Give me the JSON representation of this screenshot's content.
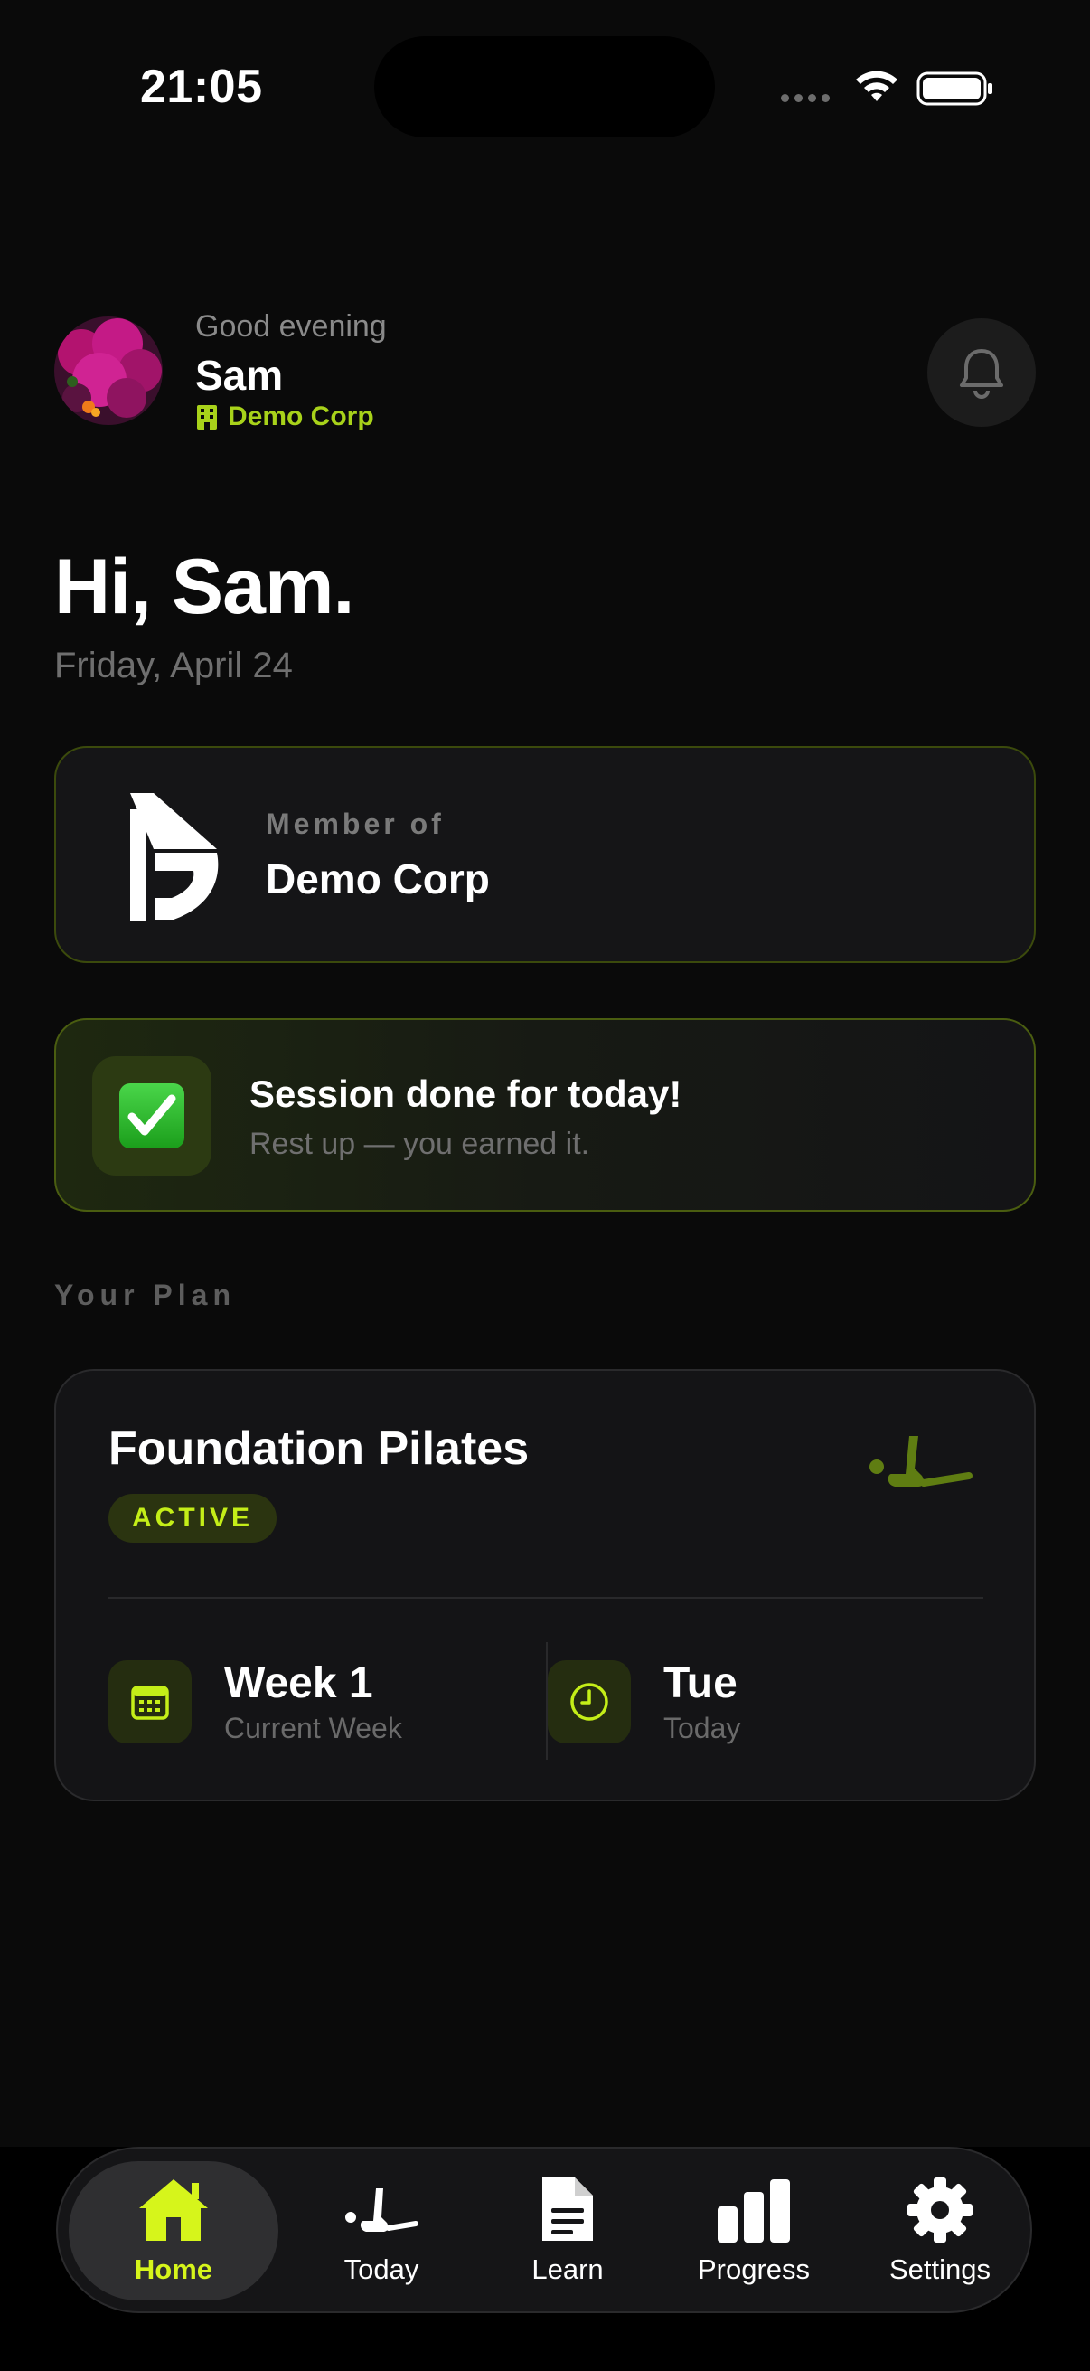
{
  "status_bar": {
    "time": "21:05"
  },
  "header": {
    "greeting": "Good evening",
    "name": "Sam",
    "org": "Demo Corp"
  },
  "hero": {
    "title": "Hi, Sam.",
    "date": "Friday, April 24"
  },
  "member_card": {
    "label": "Member of",
    "org": "Demo Corp"
  },
  "session_card": {
    "title": "Session done for today!",
    "subtitle": "Rest up — you earned it."
  },
  "plan_section": {
    "label": "Your Plan"
  },
  "plan": {
    "title": "Foundation Pilates",
    "status": "ACTIVE",
    "week_value": "Week 1",
    "week_caption": "Current Week",
    "day_value": "Tue",
    "day_caption": "Today"
  },
  "tabs": [
    {
      "label": "Home",
      "icon": "home-icon",
      "active": true
    },
    {
      "label": "Today",
      "icon": "pilates-icon",
      "active": false
    },
    {
      "label": "Learn",
      "icon": "document-icon",
      "active": false
    },
    {
      "label": "Progress",
      "icon": "bar-chart-icon",
      "active": false
    },
    {
      "label": "Settings",
      "icon": "gear-icon",
      "active": false
    }
  ],
  "colors": {
    "accent": "#d6f51b",
    "org_green": "#a8d21a",
    "background": "#0a0a0a",
    "card": "#151517"
  }
}
